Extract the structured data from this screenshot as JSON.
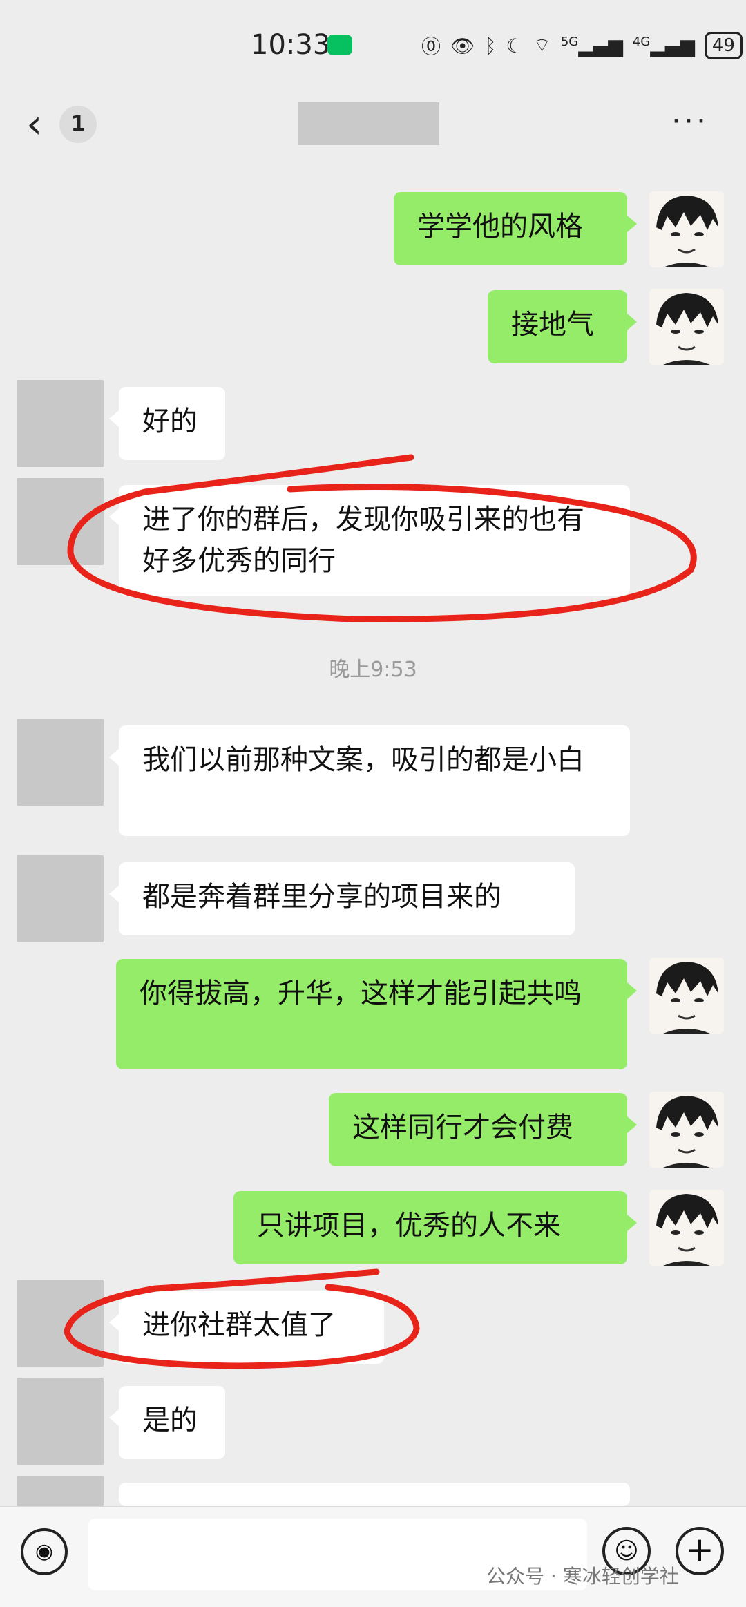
{
  "status_bar": {
    "time": "10:33",
    "icons": [
      "wechat-notification-icon",
      "nfc-icon",
      "eye-icon",
      "bluetooth-icon",
      "moon-icon",
      "wifi-icon",
      "5g-signal-icon",
      "4g-signal-icon"
    ],
    "network_1": "5G",
    "network_2": "4G",
    "battery": "49"
  },
  "nav": {
    "back_icon": "‹",
    "unread_count": "1",
    "more_icon": "···"
  },
  "messages": [
    {
      "side": "me",
      "text": "学学他的风格"
    },
    {
      "side": "me",
      "text": "接地气"
    },
    {
      "side": "other",
      "text": "好的"
    },
    {
      "side": "other",
      "text": "进了你的群后，发现你吸引来的也有好多优秀的同行",
      "circled": true
    },
    {
      "side": "other",
      "text": "我们以前那种文案，吸引的都是小白"
    },
    {
      "side": "other",
      "text": "都是奔着群里分享的项目来的"
    },
    {
      "side": "me",
      "text": "你得拔高，升华，这样才能引起共鸣"
    },
    {
      "side": "me",
      "text": "这样同行才会付费"
    },
    {
      "side": "me",
      "text": "只讲项目，优秀的人不来"
    },
    {
      "side": "other",
      "text": "进你社群太值了",
      "circled": true
    },
    {
      "side": "other",
      "text": "是的"
    },
    {
      "side": "other",
      "text": ""
    }
  ],
  "timestamp": "晚上9:53",
  "input_bar": {
    "voice_icon": "◉",
    "emoji_icon": "☺",
    "plus_icon": "+"
  },
  "watermark": "公众号 · 寒冰轻创学社",
  "colors": {
    "my_bubble": "#95ec69",
    "other_bubble": "#ffffff",
    "background": "#ededed",
    "annotation": "#e8231a"
  }
}
